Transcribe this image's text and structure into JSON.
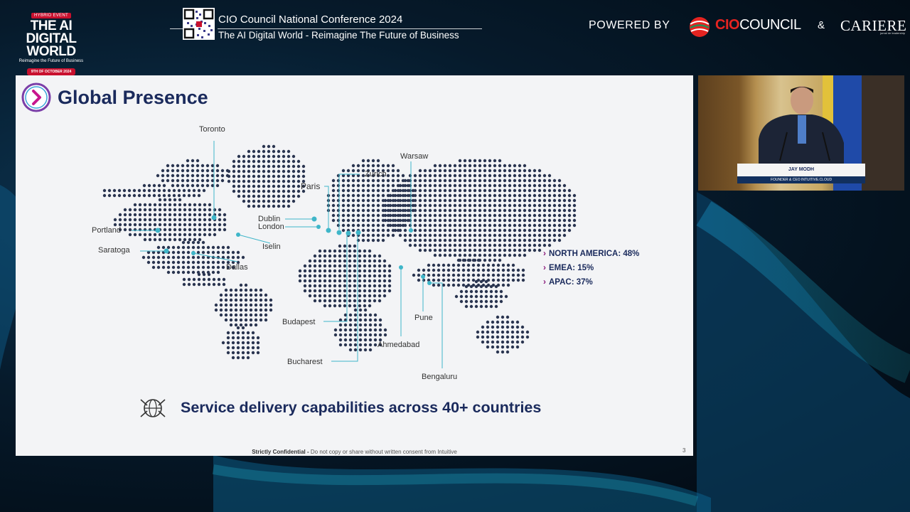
{
  "event_logo": {
    "badge": "HYBRID EVENT",
    "line1": "THE AI",
    "line2": "DIGITAL",
    "line3": "WORLD",
    "tagline": "Reimagine the Future of Business",
    "date": "9TH OF OCTOBER 2024"
  },
  "header": {
    "conference_title": "CIO Council National Conference 2024",
    "conference_subtitle": "The AI Digital World - Reimagine The Future of Business",
    "powered_by": "POWERED BY",
    "sponsor1_brand": "CIO",
    "sponsor1_rest": "COUNCIL",
    "ampersand": "&",
    "sponsor2": "CARIERE",
    "sponsor2_sub": "jurnal de leadership"
  },
  "slide": {
    "title": "Global Presence",
    "regions": [
      {
        "label": "NORTH AMERICA: 48%"
      },
      {
        "label": "EMEA: 15%"
      },
      {
        "label": "APAC: 37%"
      }
    ],
    "service_text": "Service delivery capabilities across 40+ countries",
    "footer_bold": "Strictly Confidential -",
    "footer_rest": " Do not copy or share without written consent from Intuitive",
    "page_number": "3",
    "accent_color": "#1a2a5c",
    "marker_color": "#3fb6c9",
    "cities": {
      "toronto": "Toronto",
      "portland": "Portland",
      "saratoga": "Saratoga",
      "dallas": "Dallas",
      "iselin": "Iselin",
      "dublin": "Dublin",
      "london": "London",
      "paris": "Paris",
      "zurich": "Zurich",
      "warsaw": "Warsaw",
      "budapest": "Budapest",
      "bucharest": "Bucharest",
      "ahmedabad": "Ahmedabad",
      "pune": "Pune",
      "bengaluru": "Bengaluru"
    }
  },
  "speaker": {
    "name": "JAY MODH",
    "role": "FOUNDER & CEO INTUITIVE.CLOUD"
  }
}
